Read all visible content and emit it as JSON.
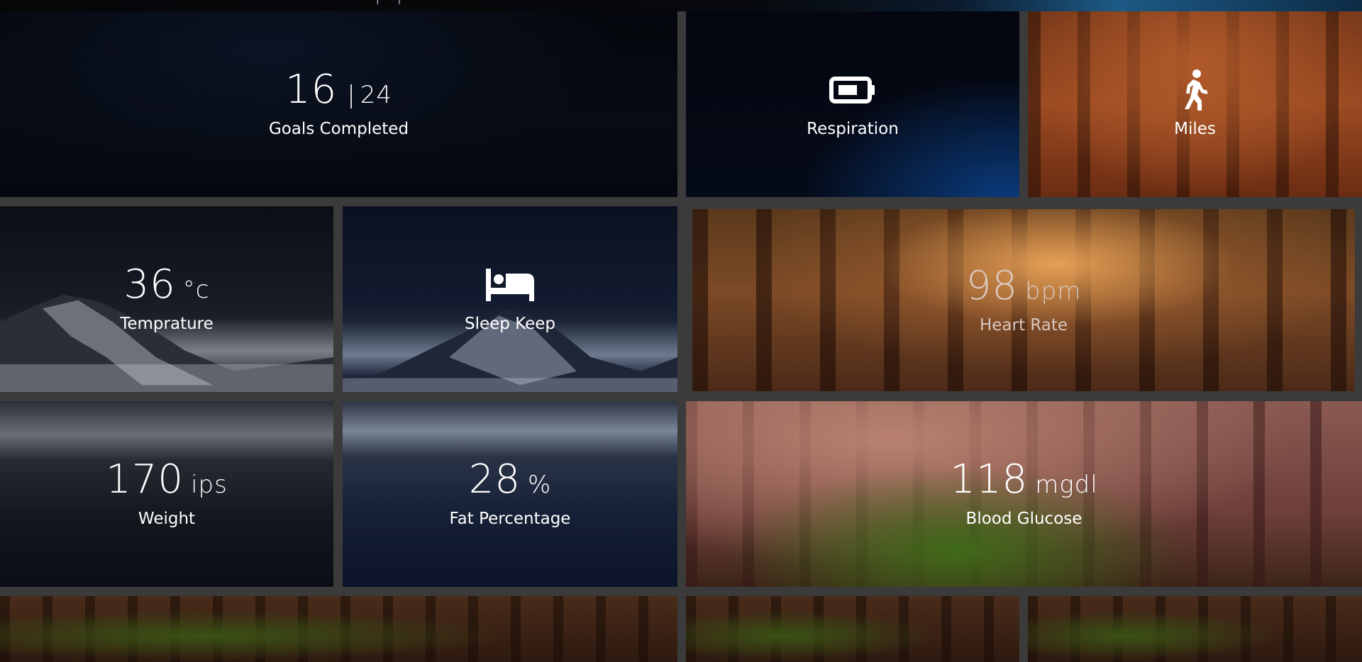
{
  "top_strip": {
    "text": "·  |  ·  ·  |  ·"
  },
  "tiles": {
    "goals": {
      "value": "16",
      "total": "24",
      "separator": "|",
      "label": "Goals Completed"
    },
    "respiration": {
      "icon": "battery-icon",
      "label": "Respiration"
    },
    "miles": {
      "icon": "walking-person-icon",
      "label": "Miles"
    },
    "temperature": {
      "value": "36",
      "unit": "°c",
      "label": "Temprature"
    },
    "sleep": {
      "icon": "bed-icon",
      "label": "Sleep Keep"
    },
    "heart": {
      "value": "98",
      "unit": "bpm",
      "label": "Heart Rate"
    },
    "weight": {
      "value": "170",
      "unit": "ips",
      "label": "Weight"
    },
    "fat": {
      "value": "28",
      "unit": "%",
      "label": "Fat Percentage"
    },
    "glucose": {
      "value": "118",
      "unit": "mgdl",
      "label": "Blood Glucose"
    }
  },
  "colors": {
    "gutter": "#3b3b3b",
    "text": "#ffffff",
    "heart_text": "#d9c7bd"
  }
}
